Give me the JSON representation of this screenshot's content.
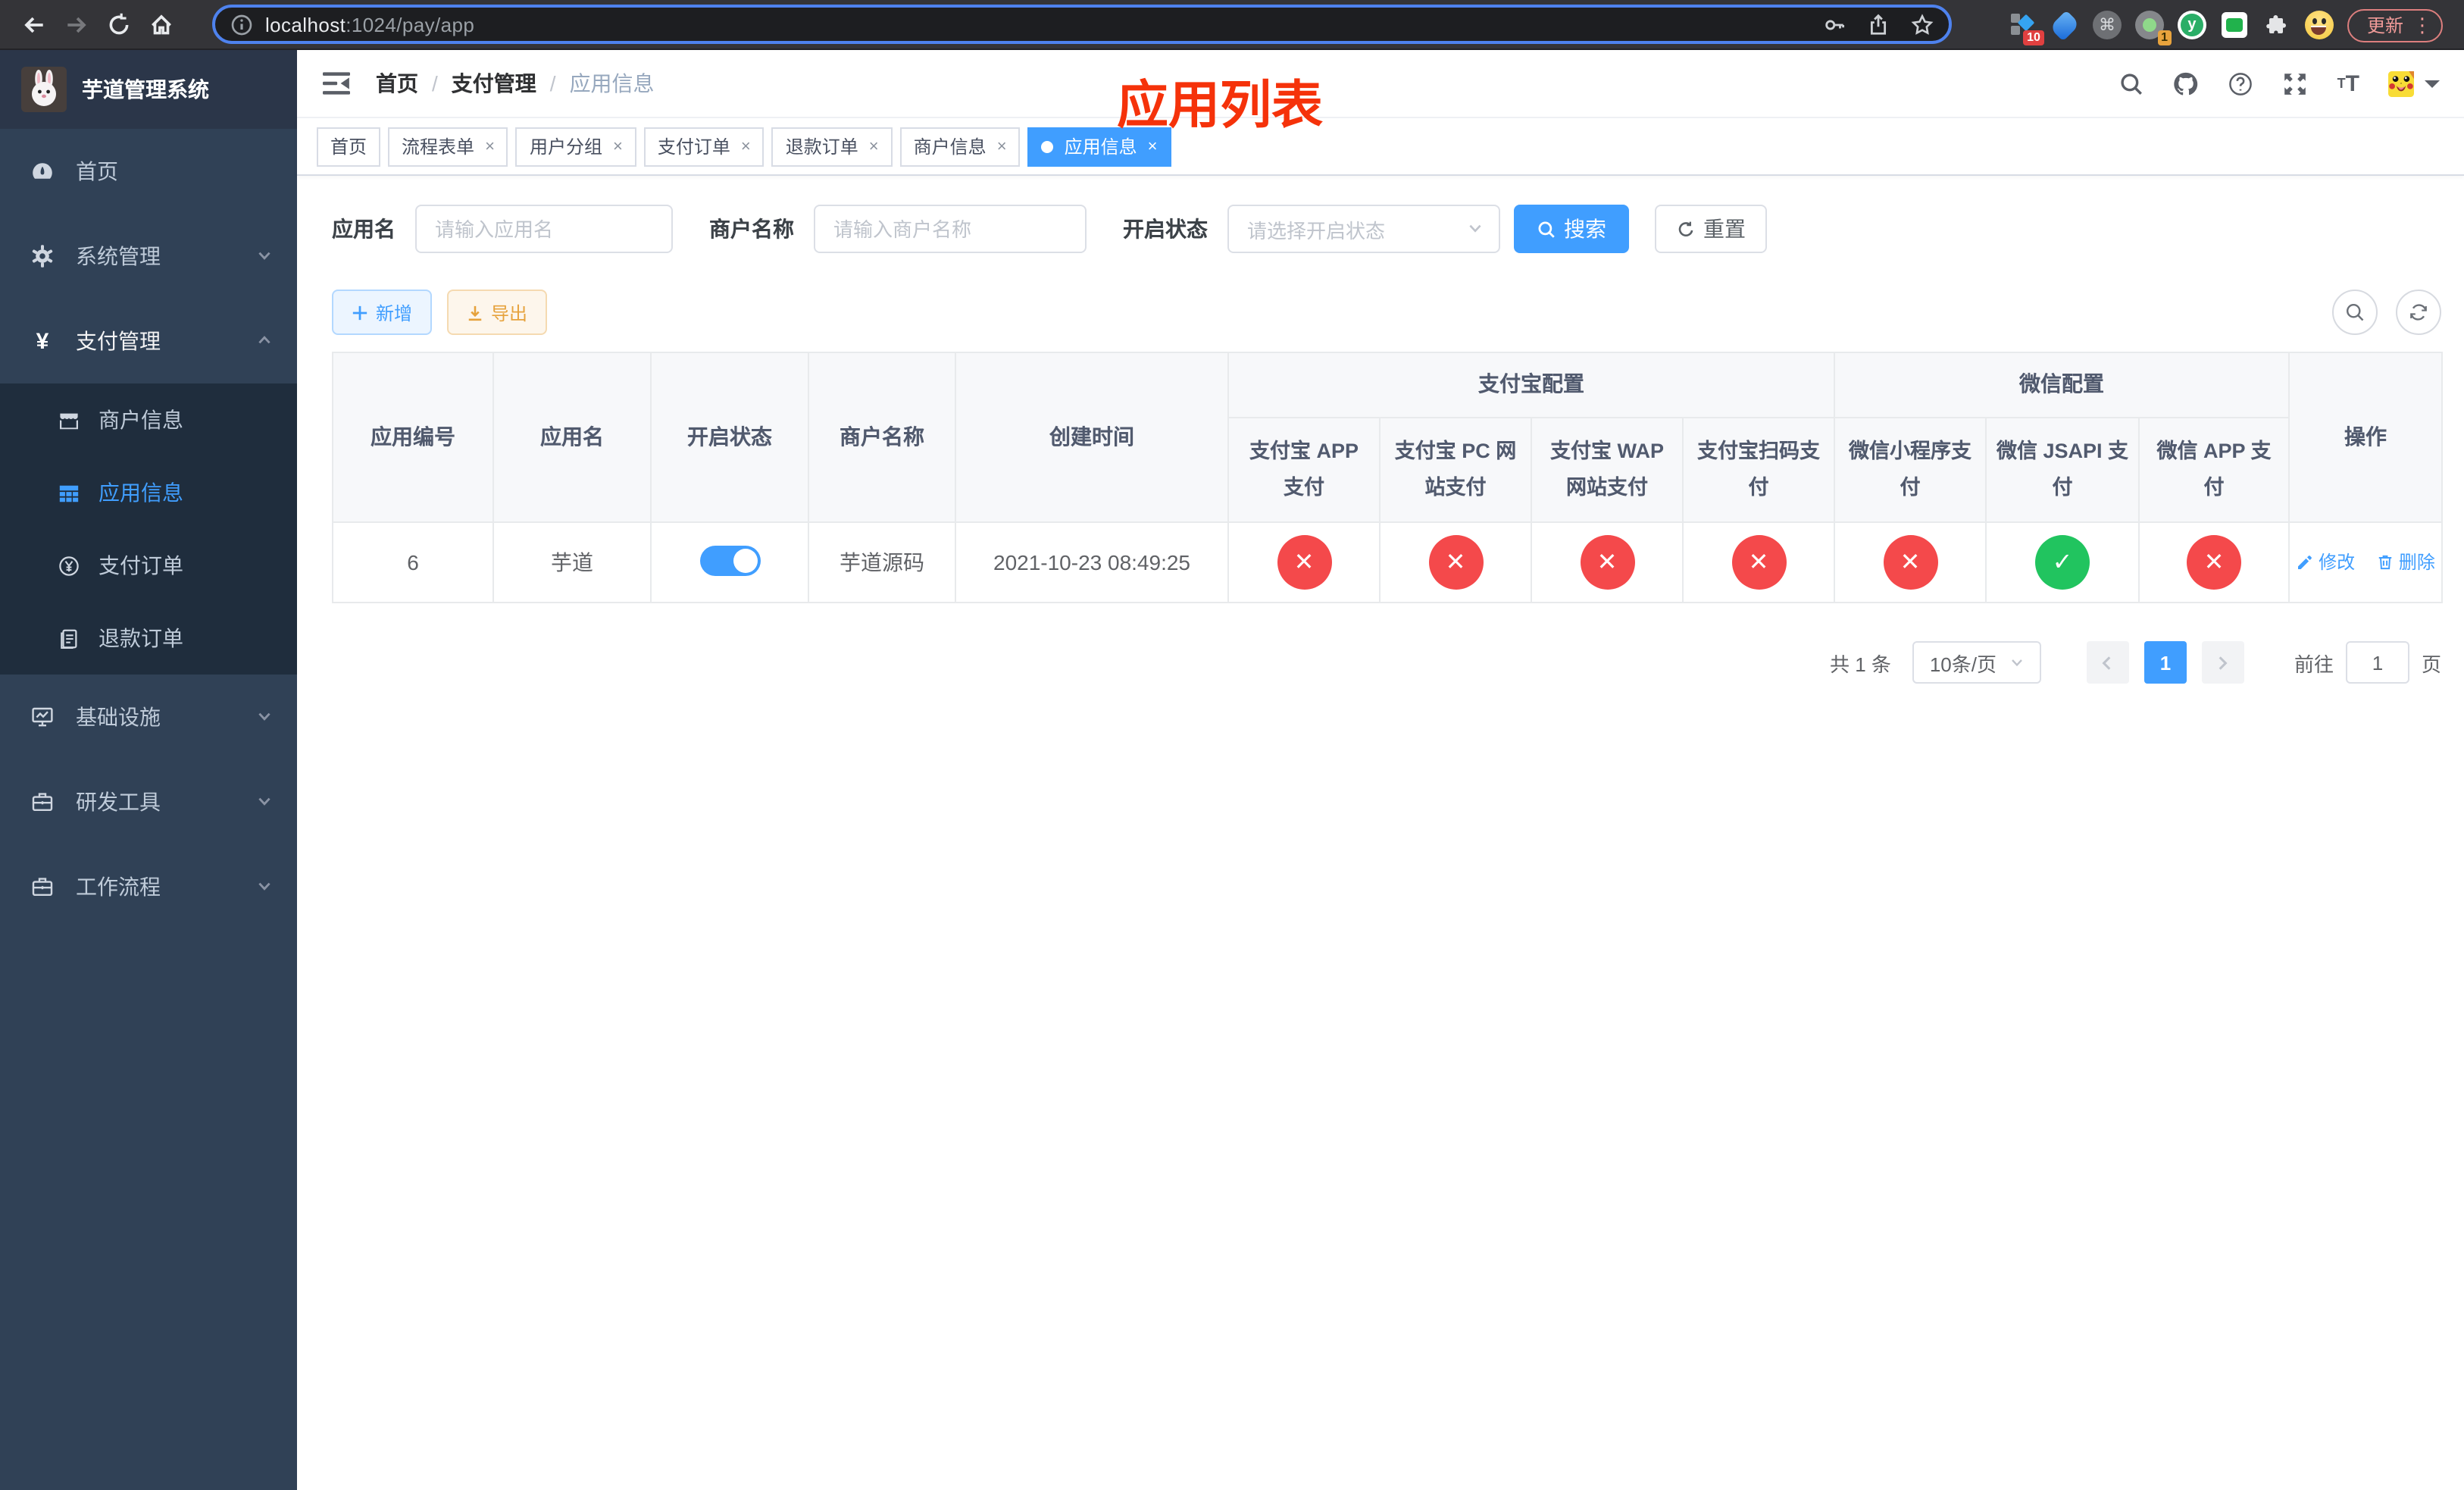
{
  "browser": {
    "url": {
      "host": "localhost",
      "path": ":1024/pay/app"
    },
    "update_button": "更新",
    "extensions": {
      "dock_badge": "10",
      "recorder_badge": "1",
      "yuque_letter": "y",
      "cmd_glyph": "⌘",
      "kebab_glyph": "⋮"
    }
  },
  "sidebar": {
    "logo_title": "芋道管理系统",
    "items": [
      {
        "label": "首页"
      },
      {
        "label": "系统管理"
      },
      {
        "label": "支付管理"
      },
      {
        "label": "商户信息"
      },
      {
        "label": "应用信息"
      },
      {
        "label": "支付订单"
      },
      {
        "label": "退款订单"
      },
      {
        "label": "基础设施"
      },
      {
        "label": "研发工具"
      },
      {
        "label": "工作流程"
      }
    ],
    "yen_glyph": "¥"
  },
  "navbar": {
    "breadcrumb": [
      "首页",
      "支付管理",
      "应用信息"
    ],
    "page_title": "应用列表",
    "help_glyph": "?",
    "font_small": "T",
    "font_big": "T"
  },
  "tabs": [
    {
      "label": "首页",
      "closable": false,
      "active": false
    },
    {
      "label": "流程表单",
      "closable": true,
      "active": false
    },
    {
      "label": "用户分组",
      "closable": true,
      "active": false
    },
    {
      "label": "支付订单",
      "closable": true,
      "active": false
    },
    {
      "label": "退款订单",
      "closable": true,
      "active": false
    },
    {
      "label": "商户信息",
      "closable": true,
      "active": false
    },
    {
      "label": "应用信息",
      "closable": true,
      "active": true
    }
  ],
  "tab_close_glyph": "×",
  "filter": {
    "app_name_label": "应用名",
    "app_name_placeholder": "请输入应用名",
    "merchant_label": "商户名称",
    "merchant_placeholder": "请输入商户名称",
    "status_label": "开启状态",
    "status_placeholder": "请选择开启状态",
    "search_label": "搜索",
    "reset_label": "重置"
  },
  "toolbar": {
    "add_label": "新增",
    "export_label": "导出"
  },
  "table": {
    "group_headers": {
      "alipay": "支付宝配置",
      "wechat": "微信配置"
    },
    "columns": [
      "应用编号",
      "应用名",
      "开启状态",
      "商户名称",
      "创建时间",
      "支付宝 APP 支付",
      "支付宝 PC 网站支付",
      "支付宝 WAP 网站支付",
      "支付宝扫码支付",
      "微信小程序支付",
      "微信 JSAPI 支付",
      "微信 APP 支付",
      "操作"
    ],
    "row": {
      "id": "6",
      "name": "芋道",
      "enabled": true,
      "merchant": "芋道源码",
      "created": "2021-10-23 08:49:25",
      "statuses": [
        {
          "state": "closed",
          "glyph": "✕"
        },
        {
          "state": "closed",
          "glyph": "✕"
        },
        {
          "state": "closed",
          "glyph": "✕"
        },
        {
          "state": "closed",
          "glyph": "✕"
        },
        {
          "state": "closed",
          "glyph": "✕"
        },
        {
          "state": "open",
          "glyph": "✓"
        },
        {
          "state": "closed",
          "glyph": "✕"
        }
      ],
      "actions": {
        "edit": "修改",
        "delete": "删除"
      }
    }
  },
  "pagination": {
    "total": "共 1 条",
    "page_size": "10条/页",
    "current_page": "1",
    "goto_label": "前往",
    "goto_value": "1",
    "goto_suffix": "页"
  },
  "colors": {
    "primary": "#409eff",
    "status_closed": "#f4494b",
    "status_open": "#21c45f",
    "overlay_title": "#f5320a",
    "sidebar_bg": "#304156",
    "submenu_bg": "#1f2d3d"
  }
}
